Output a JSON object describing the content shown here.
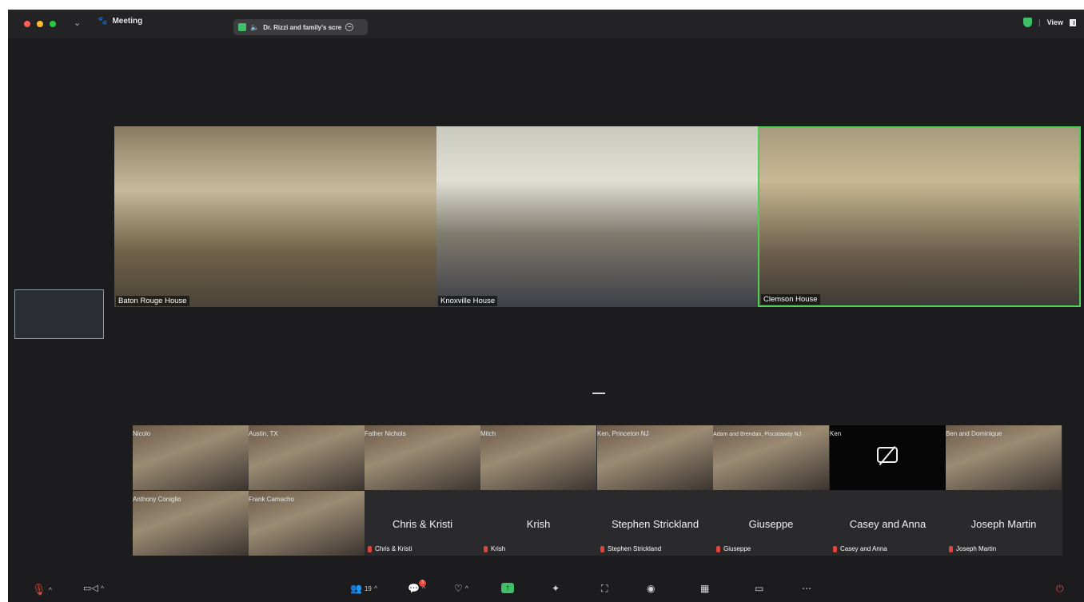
{
  "titlebar": {
    "traffic_colors": [
      "#ff5f57",
      "#febc2e",
      "#28c840"
    ],
    "chevron_icon": "chevron-down",
    "meeting_label": "Meeting",
    "share_pill_text": "Dr. Rizzi and family's scre",
    "view_label": "View"
  },
  "rooms": [
    {
      "name": "Baton Rouge House"
    },
    {
      "name": "Knoxville House"
    },
    {
      "name": "Clemson House"
    }
  ],
  "participants": {
    "row1": [
      {
        "name": "Nicolo",
        "camera": "on"
      },
      {
        "name": "Austin, TX",
        "camera": "on"
      },
      {
        "name": "Father Nichols",
        "camera": "on"
      },
      {
        "name": "Mitch",
        "camera": "on"
      },
      {
        "name": "Ken, Princeton NJ",
        "camera": "on"
      },
      {
        "name": "Adam and Brendan, Piscataway NJ",
        "camera": "on"
      },
      {
        "name": "Ken",
        "camera": "off-icon"
      },
      {
        "name": "Ben and Dominique",
        "camera": "on"
      }
    ],
    "row2": [
      {
        "name": "Anthony Coniglio",
        "camera": "on"
      },
      {
        "name": "Frank Camacho",
        "camera": "on"
      },
      {
        "name": "Chris & Kristi",
        "camera": "off"
      },
      {
        "name": "Krish",
        "camera": "off"
      },
      {
        "name": "Stephen Strickland",
        "camera": "off"
      },
      {
        "name": "Giuseppe",
        "camera": "off"
      },
      {
        "name": "Casey and Anna",
        "camera": "off"
      },
      {
        "name": "Joseph Martin",
        "camera": "off"
      }
    ]
  },
  "toolbar": {
    "participants_count": "19",
    "chat_badge": "3",
    "colors": {
      "accent_green": "#3fbf6a",
      "mute_red": "#e0443a",
      "active_border": "#4fcf56"
    }
  }
}
